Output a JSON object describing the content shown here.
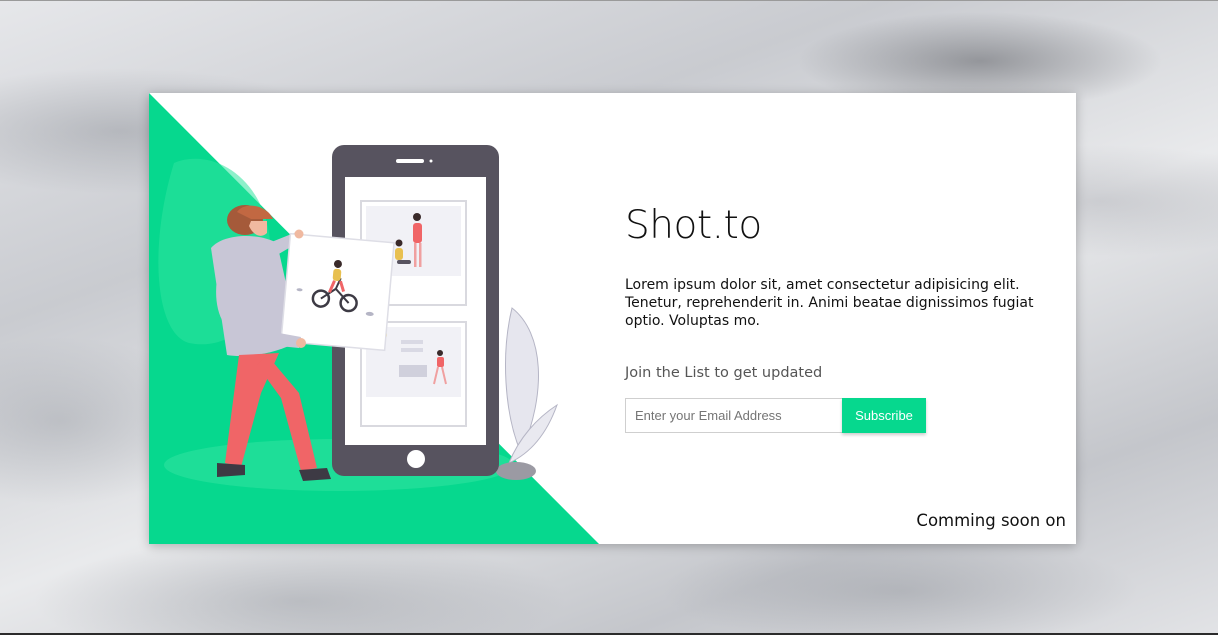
{
  "brand": {
    "title": "Shot.to"
  },
  "hero": {
    "description": "Lorem ipsum dolor sit, amet consectetur adipisicing elit. Tenetur, reprehenderit in. Animi beatae dignissimos fugiat optio. Voluptas mo."
  },
  "signup": {
    "heading": "Join the List to get updated",
    "email_placeholder": "Enter your Email Address",
    "subscribe_label": "Subscribe"
  },
  "footer": {
    "coming_soon": "Comming soon on"
  },
  "colors": {
    "accent": "#06d88e",
    "phone": "#57535f",
    "person_pants": "#f06567",
    "person_shirt": "#c8c6d6"
  }
}
